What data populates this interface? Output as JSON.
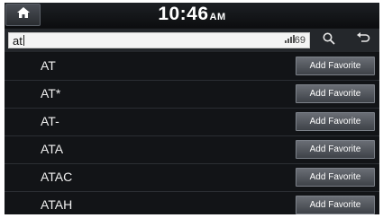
{
  "header": {
    "time": "10:46",
    "ampm": "AM"
  },
  "search": {
    "value": "at",
    "count": "69"
  },
  "results": [
    {
      "label": "AT",
      "button": "Add Favorite"
    },
    {
      "label": "AT*",
      "button": "Add Favorite"
    },
    {
      "label": "AT-",
      "button": "Add Favorite"
    },
    {
      "label": "ATA",
      "button": "Add Favorite"
    },
    {
      "label": "ATAC",
      "button": "Add Favorite"
    },
    {
      "label": "ATAH",
      "button": "Add Favorite"
    }
  ]
}
